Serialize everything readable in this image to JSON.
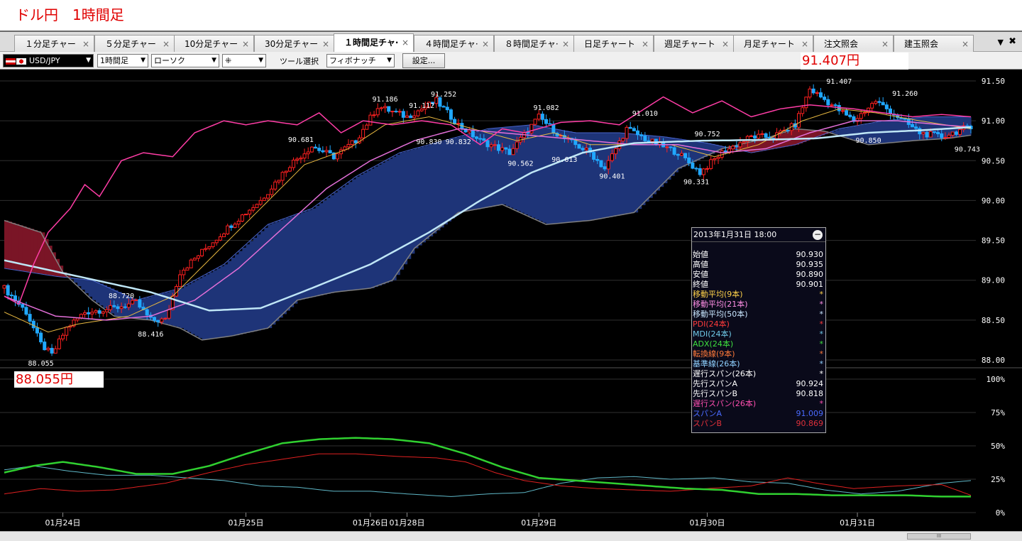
{
  "header": {
    "title": "ドル円　1時間足"
  },
  "tabs": [
    {
      "label": "１分足チャー",
      "active": false
    },
    {
      "label": "５分足チャー",
      "active": false
    },
    {
      "label": "10分足チャー",
      "active": false
    },
    {
      "label": "30分足チャー",
      "active": false
    },
    {
      "label": "１時間足チャ·",
      "active": true
    },
    {
      "label": "４時間足チャ·",
      "active": false
    },
    {
      "label": "８時間足チャ·",
      "active": false
    },
    {
      "label": "日足チャート",
      "active": false
    },
    {
      "label": "週足チャート",
      "active": false
    },
    {
      "label": "月足チャート",
      "active": false
    },
    {
      "label": "注文照会",
      "active": false
    },
    {
      "label": "建玉照会",
      "active": false
    }
  ],
  "tab_close_glyph": "×",
  "tab_menu_glyph": "▼",
  "tab_close_all_glyph": "✖",
  "toolbar": {
    "symbol": "USD/JPY",
    "timeframe": "1時間足",
    "chart_type": "ローソク",
    "drawing_mode": "⁜",
    "tool_label": "ツール選択",
    "tool": "フィボナッチ",
    "settings_label": "設定..."
  },
  "price_high_label": "91.407円",
  "price_low_label": "88.055円",
  "chart_data": {
    "type": "candlestick",
    "symbol": "USD/JPY",
    "timeframe": "1時間足",
    "price_axis": {
      "ticks": [
        "91.50",
        "91.00",
        "90.50",
        "90.00",
        "89.50",
        "89.00",
        "88.50",
        "88.00"
      ],
      "range": [
        87.95,
        91.6
      ]
    },
    "oscillator_axis": {
      "ticks": [
        "100%",
        "75%",
        "50%",
        "25%",
        "0%"
      ],
      "range": [
        0,
        100
      ]
    },
    "x_labels": [
      "01月24日",
      "01月25日",
      "01月26日",
      "01月28日",
      "01月29日",
      "01月30日",
      "01月31日"
    ],
    "x_label_pos": [
      16,
      67,
      102,
      112,
      149,
      196,
      238
    ],
    "bar_count": 265,
    "close_anchors": [
      [
        0,
        88.9
      ],
      [
        6,
        88.6
      ],
      [
        10,
        88.2
      ],
      [
        13,
        88.06
      ],
      [
        17,
        88.4
      ],
      [
        22,
        88.6
      ],
      [
        30,
        88.65
      ],
      [
        36,
        88.72
      ],
      [
        40,
        88.5
      ],
      [
        44,
        88.5
      ],
      [
        48,
        89.1
      ],
      [
        55,
        89.4
      ],
      [
        62,
        89.7
      ],
      [
        70,
        90.0
      ],
      [
        78,
        90.45
      ],
      [
        84,
        90.68
      ],
      [
        90,
        90.55
      ],
      [
        96,
        90.75
      ],
      [
        102,
        91.18
      ],
      [
        110,
        91.05
      ],
      [
        118,
        91.25
      ],
      [
        124,
        90.95
      ],
      [
        130,
        90.75
      ],
      [
        138,
        90.6
      ],
      [
        146,
        91.05
      ],
      [
        152,
        90.8
      ],
      [
        160,
        90.6
      ],
      [
        164,
        90.4
      ],
      [
        170,
        90.9
      ],
      [
        176,
        90.75
      ],
      [
        184,
        90.6
      ],
      [
        190,
        90.35
      ],
      [
        196,
        90.6
      ],
      [
        204,
        90.8
      ],
      [
        210,
        90.8
      ],
      [
        216,
        90.95
      ],
      [
        220,
        91.4
      ],
      [
        226,
        91.2
      ],
      [
        232,
        91.0
      ],
      [
        238,
        91.25
      ],
      [
        244,
        91.05
      ],
      [
        250,
        90.85
      ],
      [
        256,
        90.8
      ],
      [
        262,
        90.9
      ],
      [
        264,
        90.9
      ]
    ],
    "price_labels": [
      {
        "text": "88.055",
        "bar": 10,
        "price": 88.055,
        "pos": "below"
      },
      {
        "text": "88.720",
        "bar": 32,
        "price": 88.72,
        "pos": "above"
      },
      {
        "text": "88.416",
        "bar": 40,
        "price": 88.42,
        "pos": "below"
      },
      {
        "text": "90.681",
        "bar": 81,
        "price": 90.68,
        "pos": "above"
      },
      {
        "text": "91.186",
        "bar": 104,
        "price": 91.19,
        "pos": "above"
      },
      {
        "text": "91.112",
        "bar": 114,
        "price": 91.11,
        "pos": "above"
      },
      {
        "text": "91.252",
        "bar": 120,
        "price": 91.25,
        "pos": "above"
      },
      {
        "text": "90.830",
        "bar": 116,
        "price": 90.83,
        "pos": "below"
      },
      {
        "text": "90.832",
        "bar": 124,
        "price": 90.83,
        "pos": "below"
      },
      {
        "text": "91.082",
        "bar": 148,
        "price": 91.08,
        "pos": "above"
      },
      {
        "text": "90.562",
        "bar": 141,
        "price": 90.56,
        "pos": "below"
      },
      {
        "text": "90.613",
        "bar": 153,
        "price": 90.61,
        "pos": "below"
      },
      {
        "text": "91.010",
        "bar": 175,
        "price": 91.01,
        "pos": "above"
      },
      {
        "text": "90.401",
        "bar": 166,
        "price": 90.4,
        "pos": "below"
      },
      {
        "text": "90.752",
        "bar": 192,
        "price": 90.75,
        "pos": "above"
      },
      {
        "text": "90.331",
        "bar": 189,
        "price": 90.33,
        "pos": "below"
      },
      {
        "text": "91.407",
        "bar": 228,
        "price": 91.41,
        "pos": "above"
      },
      {
        "text": "91.260",
        "bar": 246,
        "price": 91.26,
        "pos": "above"
      },
      {
        "text": "90.850",
        "bar": 236,
        "price": 90.85,
        "pos": "below"
      },
      {
        "text": "90.743",
        "bar": 263,
        "price": 90.74,
        "pos": "below"
      }
    ],
    "cloud_a_anchors": [
      [
        0,
        89.15
      ],
      [
        14,
        89.05
      ],
      [
        24,
        89.0
      ],
      [
        36,
        88.75
      ],
      [
        48,
        88.9
      ],
      [
        60,
        89.2
      ],
      [
        72,
        89.7
      ],
      [
        84,
        89.9
      ],
      [
        96,
        90.3
      ],
      [
        108,
        90.6
      ],
      [
        120,
        90.75
      ],
      [
        132,
        90.9
      ],
      [
        144,
        90.95
      ],
      [
        156,
        90.85
      ],
      [
        168,
        90.85
      ],
      [
        180,
        90.8
      ],
      [
        192,
        90.72
      ],
      [
        204,
        90.6
      ],
      [
        216,
        90.7
      ],
      [
        228,
        90.9
      ],
      [
        240,
        91.0
      ],
      [
        252,
        91.05
      ],
      [
        264,
        91.05
      ]
    ],
    "cloud_b_anchors": [
      [
        0,
        89.75
      ],
      [
        10,
        89.6
      ],
      [
        16,
        89.1
      ],
      [
        24,
        88.75
      ],
      [
        30,
        88.55
      ],
      [
        40,
        88.5
      ],
      [
        48,
        88.4
      ],
      [
        54,
        88.25
      ],
      [
        62,
        88.3
      ],
      [
        72,
        88.4
      ],
      [
        80,
        88.75
      ],
      [
        90,
        88.85
      ],
      [
        100,
        88.9
      ],
      [
        106,
        89.0
      ],
      [
        112,
        89.4
      ],
      [
        124,
        89.85
      ],
      [
        136,
        89.95
      ],
      [
        148,
        89.7
      ],
      [
        160,
        89.75
      ],
      [
        172,
        89.85
      ],
      [
        184,
        90.4
      ],
      [
        196,
        90.65
      ],
      [
        208,
        90.78
      ],
      [
        216,
        90.9
      ],
      [
        224,
        90.87
      ],
      [
        236,
        90.7
      ],
      [
        248,
        90.75
      ],
      [
        258,
        90.78
      ],
      [
        264,
        90.82
      ]
    ],
    "chikou_anchors": [
      [
        0,
        88.8
      ],
      [
        4,
        88.7
      ],
      [
        8,
        89.2
      ],
      [
        12,
        89.6
      ],
      [
        18,
        89.9
      ],
      [
        22,
        90.2
      ],
      [
        26,
        90.05
      ],
      [
        32,
        90.5
      ],
      [
        38,
        90.6
      ],
      [
        46,
        90.55
      ],
      [
        52,
        90.85
      ],
      [
        60,
        91.0
      ],
      [
        66,
        90.95
      ],
      [
        72,
        91.0
      ],
      [
        80,
        90.95
      ],
      [
        86,
        91.1
      ],
      [
        92,
        90.85
      ],
      [
        98,
        91.0
      ],
      [
        106,
        90.95
      ],
      [
        114,
        91.0
      ],
      [
        122,
        90.95
      ],
      [
        130,
        90.7
      ],
      [
        136,
        90.9
      ],
      [
        142,
        90.85
      ],
      [
        152,
        90.98
      ],
      [
        160,
        91.0
      ],
      [
        168,
        90.95
      ],
      [
        180,
        91.3
      ],
      [
        188,
        91.1
      ],
      [
        196,
        91.25
      ],
      [
        204,
        91.05
      ],
      [
        212,
        91.15
      ],
      [
        220,
        91.2
      ],
      [
        232,
        91.15
      ],
      [
        240,
        91.1
      ],
      [
        248,
        91.05
      ],
      [
        256,
        91.08
      ],
      [
        264,
        91.05
      ]
    ],
    "ma9_anchors": [
      [
        0,
        88.6
      ],
      [
        12,
        88.35
      ],
      [
        20,
        88.45
      ],
      [
        34,
        88.55
      ],
      [
        46,
        88.8
      ],
      [
        58,
        89.35
      ],
      [
        70,
        89.9
      ],
      [
        82,
        90.45
      ],
      [
        94,
        90.65
      ],
      [
        104,
        90.95
      ],
      [
        116,
        91.05
      ],
      [
        128,
        90.9
      ],
      [
        140,
        90.75
      ],
      [
        150,
        90.85
      ],
      [
        160,
        90.7
      ],
      [
        170,
        90.7
      ],
      [
        182,
        90.7
      ],
      [
        194,
        90.55
      ],
      [
        206,
        90.7
      ],
      [
        218,
        91.0
      ],
      [
        228,
        91.15
      ],
      [
        238,
        91.1
      ],
      [
        250,
        91.0
      ],
      [
        264,
        90.9
      ]
    ],
    "ma21_anchors": [
      [
        0,
        88.8
      ],
      [
        14,
        88.55
      ],
      [
        28,
        88.5
      ],
      [
        40,
        88.55
      ],
      [
        52,
        88.75
      ],
      [
        64,
        89.15
      ],
      [
        76,
        89.65
      ],
      [
        88,
        90.15
      ],
      [
        100,
        90.5
      ],
      [
        112,
        90.75
      ],
      [
        124,
        90.9
      ],
      [
        136,
        90.85
      ],
      [
        148,
        90.8
      ],
      [
        160,
        90.75
      ],
      [
        172,
        90.7
      ],
      [
        184,
        90.7
      ],
      [
        196,
        90.6
      ],
      [
        208,
        90.65
      ],
      [
        220,
        90.85
      ],
      [
        232,
        91.0
      ],
      [
        244,
        91.0
      ],
      [
        256,
        90.95
      ],
      [
        264,
        90.92
      ]
    ],
    "ma50_anchors": [
      [
        0,
        89.25
      ],
      [
        20,
        89.05
      ],
      [
        40,
        88.85
      ],
      [
        56,
        88.62
      ],
      [
        70,
        88.65
      ],
      [
        84,
        88.9
      ],
      [
        100,
        89.2
      ],
      [
        116,
        89.6
      ],
      [
        130,
        90.0
      ],
      [
        144,
        90.35
      ],
      [
        158,
        90.6
      ],
      [
        172,
        90.72
      ],
      [
        190,
        90.75
      ],
      [
        206,
        90.76
      ],
      [
        222,
        90.78
      ],
      [
        236,
        90.85
      ],
      [
        250,
        90.88
      ],
      [
        264,
        90.92
      ]
    ],
    "pdi_anchors": [
      [
        0,
        14
      ],
      [
        10,
        18
      ],
      [
        20,
        16
      ],
      [
        30,
        17
      ],
      [
        44,
        22
      ],
      [
        56,
        30
      ],
      [
        66,
        36
      ],
      [
        76,
        40
      ],
      [
        86,
        44
      ],
      [
        96,
        44
      ],
      [
        108,
        42
      ],
      [
        118,
        41
      ],
      [
        126,
        38
      ],
      [
        134,
        30
      ],
      [
        142,
        24
      ],
      [
        152,
        20
      ],
      [
        162,
        18
      ],
      [
        172,
        17
      ],
      [
        182,
        16
      ],
      [
        192,
        18
      ],
      [
        204,
        20
      ],
      [
        214,
        26
      ],
      [
        222,
        22
      ],
      [
        232,
        18
      ],
      [
        244,
        20
      ],
      [
        256,
        21
      ],
      [
        264,
        13
      ]
    ],
    "mdi_anchors": [
      [
        0,
        32
      ],
      [
        8,
        35
      ],
      [
        18,
        31
      ],
      [
        28,
        28
      ],
      [
        40,
        28
      ],
      [
        50,
        26
      ],
      [
        60,
        24
      ],
      [
        70,
        20
      ],
      [
        80,
        19
      ],
      [
        90,
        16
      ],
      [
        100,
        16
      ],
      [
        110,
        14
      ],
      [
        122,
        12
      ],
      [
        132,
        14
      ],
      [
        142,
        15
      ],
      [
        152,
        22
      ],
      [
        162,
        26
      ],
      [
        172,
        27
      ],
      [
        182,
        25
      ],
      [
        194,
        26
      ],
      [
        204,
        23
      ],
      [
        214,
        22
      ],
      [
        224,
        17
      ],
      [
        234,
        14
      ],
      [
        244,
        16
      ],
      [
        256,
        22
      ],
      [
        264,
        24
      ]
    ],
    "adx_anchors": [
      [
        0,
        30
      ],
      [
        8,
        35
      ],
      [
        16,
        38
      ],
      [
        26,
        34
      ],
      [
        36,
        29
      ],
      [
        46,
        29
      ],
      [
        56,
        35
      ],
      [
        66,
        44
      ],
      [
        76,
        52
      ],
      [
        86,
        55
      ],
      [
        96,
        56
      ],
      [
        106,
        55
      ],
      [
        116,
        52
      ],
      [
        126,
        44
      ],
      [
        136,
        34
      ],
      [
        146,
        26
      ],
      [
        156,
        24
      ],
      [
        166,
        22
      ],
      [
        176,
        20
      ],
      [
        186,
        18
      ],
      [
        196,
        17
      ],
      [
        206,
        14
      ],
      [
        216,
        14
      ],
      [
        226,
        13
      ],
      [
        236,
        13
      ],
      [
        246,
        13
      ],
      [
        256,
        12
      ],
      [
        264,
        12
      ]
    ]
  },
  "info_panel": {
    "header": "2013年1月31日  18:00",
    "rows": [
      {
        "label": "始値",
        "value": "90.930",
        "color": "#ffffff"
      },
      {
        "label": "高値",
        "value": "90.935",
        "color": "#ffffff"
      },
      {
        "label": "安値",
        "value": "90.890",
        "color": "#ffffff"
      },
      {
        "label": "終値",
        "value": "90.901",
        "color": "#ffffff"
      },
      {
        "label": "移動平均(9本)",
        "value": "*",
        "color": "#ffd24a"
      },
      {
        "label": "移動平均(21本)",
        "value": "*",
        "color": "#ff8fe6"
      },
      {
        "label": "移動平均(50本)",
        "value": "*",
        "color": "#c8e6ff"
      },
      {
        "label": "PDI(24本)",
        "value": "*",
        "color": "#ff3b3b"
      },
      {
        "label": "MDI(24本)",
        "value": "*",
        "color": "#6fc9e8"
      },
      {
        "label": "ADX(24本)",
        "value": "*",
        "color": "#3ee03e"
      },
      {
        "label": "転換線(9本)",
        "value": "*",
        "color": "#ff7a3a"
      },
      {
        "label": "基準線(26本)",
        "value": "*",
        "color": "#8fd0ff"
      },
      {
        "label": "遅行スパン(26本)",
        "value": "*",
        "color": "#ffffff"
      },
      {
        "label": "先行スパンA",
        "value": "90.924",
        "color": "#ffffff"
      },
      {
        "label": "先行スパンB",
        "value": "90.818",
        "color": "#ffffff"
      },
      {
        "label": "遅行スパン(26本)",
        "value": "*",
        "color": "#ff4fb0"
      },
      {
        "label": "スパンA",
        "value": "91.009",
        "color": "#4a6bff"
      },
      {
        "label": "スパンB",
        "value": "90.869",
        "color": "#e0303a"
      }
    ]
  },
  "scrollbar": {
    "thumb_glyph": "III"
  },
  "colors": {
    "up_candle": "#ff2020",
    "down_candle": "#20a8ff",
    "cloud_bull": "#1e3478",
    "cloud_bear": "#7a1526",
    "cloud_gray": "#7f7f7f",
    "chikou": "#ff3da6",
    "ma9": "#e8b840",
    "ma21": "#e36fd8",
    "ma50": "#bfe6f6",
    "pdi": "#e02020",
    "mdi": "#5fb8c8",
    "adx": "#30d030"
  }
}
